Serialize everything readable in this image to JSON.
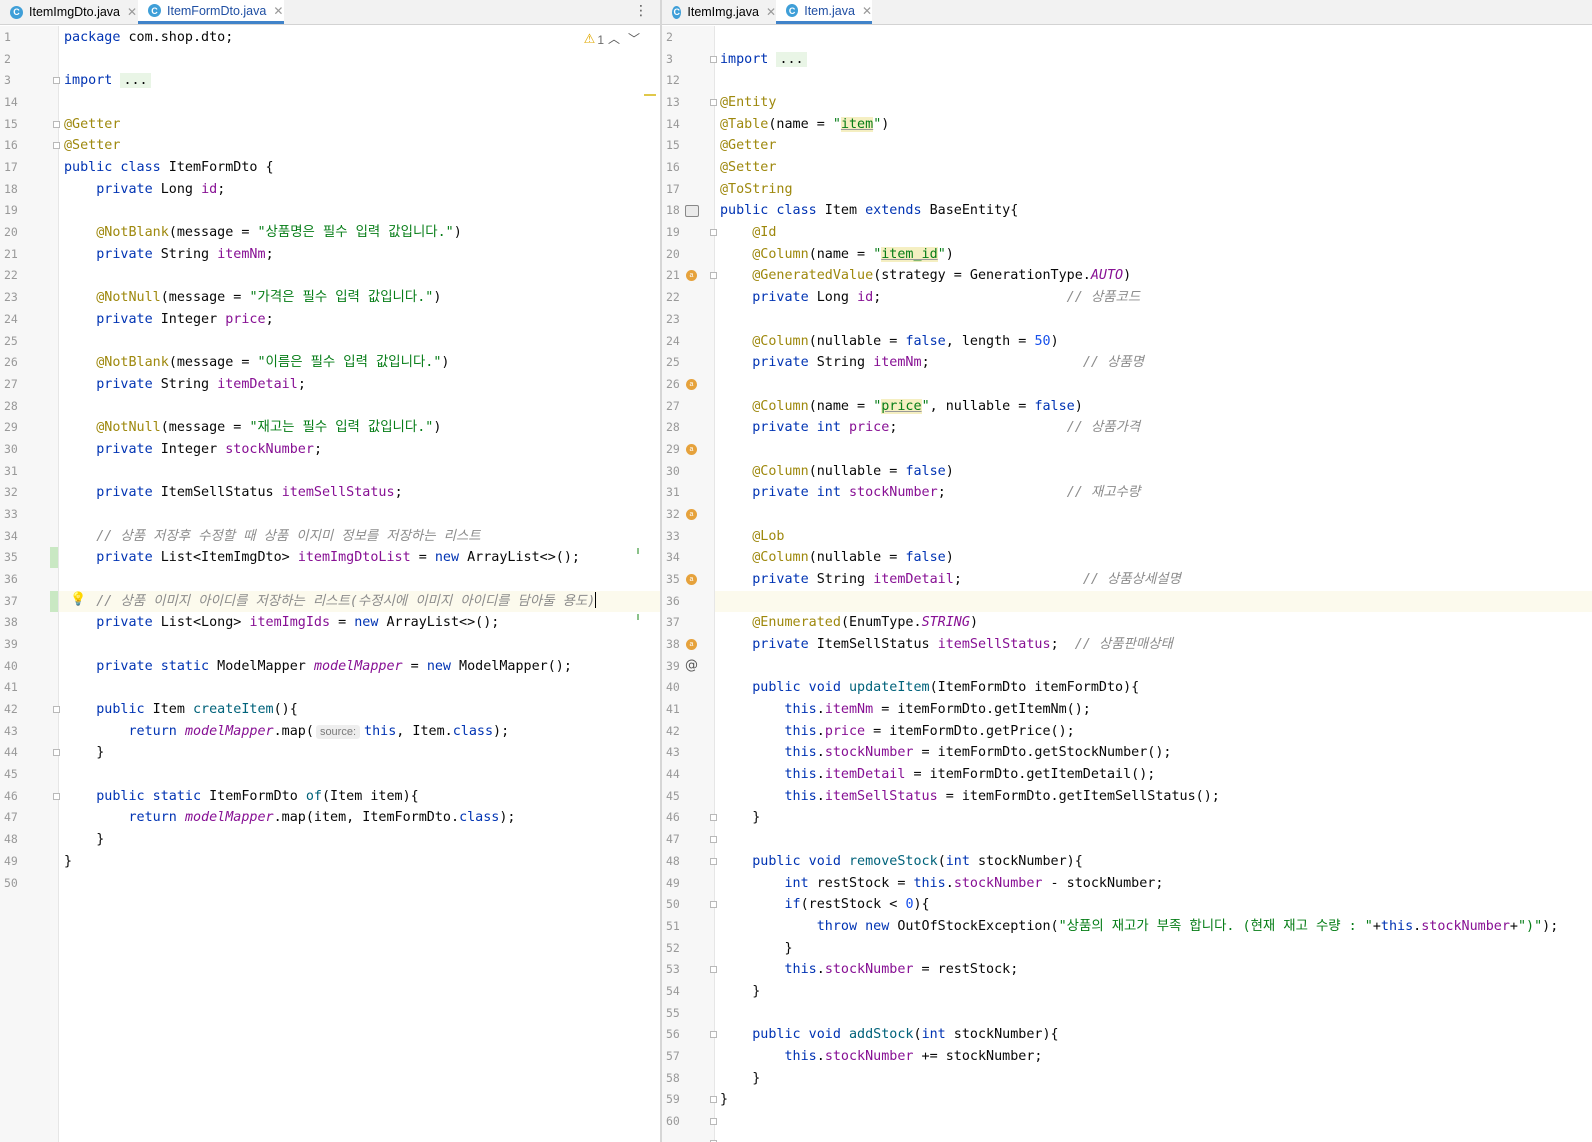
{
  "left_pane": {
    "tabs": [
      {
        "label": "ItemImgDto.java",
        "icon": "C",
        "active": false
      },
      {
        "label": "ItemFormDto.java",
        "icon": "C",
        "active": true
      }
    ],
    "warning_count": "1",
    "lines": [
      {
        "n": "1",
        "html": "<span class=\"kw\">package</span> com.shop.dto;"
      },
      {
        "n": "2",
        "html": ""
      },
      {
        "n": "3",
        "html": "<span class=\"kw\">import</span> <span class=\"fold-bg\">...</span>"
      },
      {
        "n": "14",
        "html": ""
      },
      {
        "n": "15",
        "html": "<span class=\"ann\">@Getter</span>"
      },
      {
        "n": "16",
        "html": "<span class=\"ann\">@Setter</span>"
      },
      {
        "n": "17",
        "html": "<span class=\"kw\">public class</span> ItemFormDto {"
      },
      {
        "n": "18",
        "html": "    <span class=\"kw\">private</span> Long <span class=\"fld\">id</span>;"
      },
      {
        "n": "19",
        "html": ""
      },
      {
        "n": "20",
        "html": "    <span class=\"ann\">@NotBlank</span>(message = <span class=\"str\">\"상품명은 필수 입력 값입니다.\"</span>)"
      },
      {
        "n": "21",
        "html": "    <span class=\"kw\">private</span> String <span class=\"fld\">itemNm</span>;"
      },
      {
        "n": "22",
        "html": ""
      },
      {
        "n": "23",
        "html": "    <span class=\"ann\">@NotNull</span>(message = <span class=\"str\">\"가격은 필수 입력 값입니다.\"</span>)"
      },
      {
        "n": "24",
        "html": "    <span class=\"kw\">private</span> Integer <span class=\"fld\">price</span>;"
      },
      {
        "n": "25",
        "html": ""
      },
      {
        "n": "26",
        "html": "    <span class=\"ann\">@NotBlank</span>(message = <span class=\"str\">\"이름은 필수 입력 값입니다.\"</span>)"
      },
      {
        "n": "27",
        "html": "    <span class=\"kw\">private</span> String <span class=\"fld\">itemDetail</span>;"
      },
      {
        "n": "28",
        "html": ""
      },
      {
        "n": "29",
        "html": "    <span class=\"ann\">@NotNull</span>(message = <span class=\"str\">\"재고는 필수 입력 값입니다.\"</span>)"
      },
      {
        "n": "30",
        "html": "    <span class=\"kw\">private</span> Integer <span class=\"fld\">stockNumber</span>;"
      },
      {
        "n": "31",
        "html": ""
      },
      {
        "n": "32",
        "html": "    <span class=\"kw\">private</span> ItemSellStatus <span class=\"fld\">itemSellStatus</span>;"
      },
      {
        "n": "33",
        "html": ""
      },
      {
        "n": "34",
        "html": "    <span class=\"cmt\">// 상품 저장후 수정할 때 상품 이지미 정보를 저장하는 리스트</span>"
      },
      {
        "n": "35",
        "html": "    <span class=\"kw\">private</span> List&lt;ItemImgDto&gt; <span class=\"fld\">itemImgDtoList</span> = <span class=\"kw\">new</span> ArrayList&lt;&gt;();"
      },
      {
        "n": "36",
        "html": ""
      },
      {
        "n": "37",
        "html": "    <span class=\"cmt\">// 상품 이미지 아이디를 저장하는 리스트(수정시에 이미지 아이디를 담아둘 용도)</span><span class=\"caret\"></span>",
        "current": true
      },
      {
        "n": "38",
        "html": "    <span class=\"kw\">private</span> List&lt;Long&gt; <span class=\"fld\">itemImgIds</span> = <span class=\"kw\">new</span> ArrayList&lt;&gt;();"
      },
      {
        "n": "39",
        "html": ""
      },
      {
        "n": "40",
        "html": "    <span class=\"kw\">private static</span> ModelMapper <span class=\"fldi\">modelMapper</span> = <span class=\"kw\">new</span> ModelMapper();"
      },
      {
        "n": "41",
        "html": ""
      },
      {
        "n": "42",
        "html": "    <span class=\"kw\">public</span> Item <span class=\"fn\">createItem</span>(){"
      },
      {
        "n": "43",
        "html": "        <span class=\"kw\">return</span> <span class=\"fldi\">modelMapper</span>.map(<span class=\"hint\">source:</span><span class=\"kw\">this</span>, Item.<span class=\"kw\">class</span>);"
      },
      {
        "n": "44",
        "html": "    }"
      },
      {
        "n": "45",
        "html": ""
      },
      {
        "n": "46",
        "html": "    <span class=\"kw\">public static</span> ItemFormDto <span class=\"fn\">of</span>(Item item){"
      },
      {
        "n": "47",
        "html": "        <span class=\"kw\">return</span> <span class=\"fldi\">modelMapper</span>.map(item, ItemFormDto.<span class=\"kw\">class</span>);"
      },
      {
        "n": "48",
        "html": "    }"
      },
      {
        "n": "49",
        "html": "}"
      },
      {
        "n": "50",
        "html": ""
      }
    ]
  },
  "right_pane": {
    "tabs": [
      {
        "label": "ItemImg.java",
        "icon": "C",
        "active": false
      },
      {
        "label": "Item.java",
        "icon": "C",
        "active": true
      }
    ],
    "lines": [
      {
        "n": "2",
        "html": ""
      },
      {
        "n": "3",
        "html": "<span class=\"kw\">import</span> <span class=\"fold-bg\">...</span>"
      },
      {
        "n": "12",
        "html": ""
      },
      {
        "n": "13",
        "html": "<span class=\"ann\">@Entity</span>"
      },
      {
        "n": "14",
        "html": "<span class=\"ann\">@Table</span>(name = <span class=\"str\">\"<span class=\"hl\">item</span>\"</span>)"
      },
      {
        "n": "15",
        "html": "<span class=\"ann\">@Getter</span>"
      },
      {
        "n": "16",
        "html": "<span class=\"ann\">@Setter</span>"
      },
      {
        "n": "17",
        "html": "<span class=\"ann\">@ToString</span>"
      },
      {
        "n": "18",
        "html": "<span class=\"kw\">public class</span> Item <span class=\"kw\">extends</span> BaseEntity{"
      },
      {
        "n": "19",
        "html": "    <span class=\"ann\">@Id</span>"
      },
      {
        "n": "20",
        "html": "    <span class=\"ann\">@Column</span>(name = <span class=\"str\">\"<span class=\"hl\">item_id</span>\"</span>)"
      },
      {
        "n": "21",
        "html": "    <span class=\"ann\">@GeneratedValue</span>(strategy = GenerationType.<span class=\"const\">AUTO</span>)"
      },
      {
        "n": "22",
        "html": "    <span class=\"kw\">private</span> Long <span class=\"fld\">id</span>;                       <span class=\"cmt\">// 상품코드</span>"
      },
      {
        "n": "23",
        "html": ""
      },
      {
        "n": "24",
        "html": "    <span class=\"ann\">@Column</span>(nullable = <span class=\"kw\">false</span>, length = <span class=\"num-lit\">50</span>)"
      },
      {
        "n": "25",
        "html": "    <span class=\"kw\">private</span> String <span class=\"fld\">itemNm</span>;                   <span class=\"cmt\">// 상품명</span>"
      },
      {
        "n": "26",
        "html": ""
      },
      {
        "n": "27",
        "html": "    <span class=\"ann\">@Column</span>(name = <span class=\"str\">\"<span class=\"hl\">price</span>\"</span>, nullable = <span class=\"kw\">false</span>)"
      },
      {
        "n": "28",
        "html": "    <span class=\"kw\">private int</span> <span class=\"fld\">price</span>;                     <span class=\"cmt\">// 상품가격</span>"
      },
      {
        "n": "29",
        "html": ""
      },
      {
        "n": "30",
        "html": "    <span class=\"ann\">@Column</span>(nullable = <span class=\"kw\">false</span>)"
      },
      {
        "n": "31",
        "html": "    <span class=\"kw\">private int</span> <span class=\"fld\">stockNumber</span>;               <span class=\"cmt\">// 재고수량</span>"
      },
      {
        "n": "32",
        "html": ""
      },
      {
        "n": "33",
        "html": "    <span class=\"ann\">@Lob</span>"
      },
      {
        "n": "34",
        "html": "    <span class=\"ann\">@Column</span>(nullable = <span class=\"kw\">false</span>)"
      },
      {
        "n": "35",
        "html": "    <span class=\"kw\">private</span> String <span class=\"fld\">itemDetail</span>;               <span class=\"cmt\">// 상품상세설명</span>"
      },
      {
        "n": "36",
        "html": "",
        "current": true
      },
      {
        "n": "37",
        "html": "    <span class=\"ann\">@Enumerated</span>(EnumType.<span class=\"const\">STRING</span>)"
      },
      {
        "n": "38",
        "html": "    <span class=\"kw\">private</span> ItemSellStatus <span class=\"fld\">itemSellStatus</span>;  <span class=\"cmt\">// 상품판매상태</span>"
      },
      {
        "n": "39",
        "html": ""
      },
      {
        "n": "40",
        "html": "    <span class=\"kw\">public void</span> <span class=\"fn\">updateItem</span>(ItemFormDto itemFormDto){"
      },
      {
        "n": "41",
        "html": "        <span class=\"kw\">this</span>.<span class=\"fld\">itemNm</span> = itemFormDto.getItemNm();"
      },
      {
        "n": "42",
        "html": "        <span class=\"kw\">this</span>.<span class=\"fld\">price</span> = itemFormDto.getPrice();"
      },
      {
        "n": "43",
        "html": "        <span class=\"kw\">this</span>.<span class=\"fld\">stockNumber</span> = itemFormDto.getStockNumber();"
      },
      {
        "n": "44",
        "html": "        <span class=\"kw\">this</span>.<span class=\"fld\">itemDetail</span> = itemFormDto.getItemDetail();"
      },
      {
        "n": "45",
        "html": "        <span class=\"kw\">this</span>.<span class=\"fld\">itemSellStatus</span> = itemFormDto.getItemSellStatus();"
      },
      {
        "n": "46",
        "html": "    }"
      },
      {
        "n": "47",
        "html": ""
      },
      {
        "n": "48",
        "html": "    <span class=\"kw\">public void</span> <span class=\"fn\">removeStock</span>(<span class=\"kw\">int</span> stockNumber){"
      },
      {
        "n": "49",
        "html": "        <span class=\"kw\">int</span> restStock = <span class=\"kw\">this</span>.<span class=\"fld\">stockNumber</span> - stockNumber;"
      },
      {
        "n": "50",
        "html": "        <span class=\"kw\">if</span>(restStock &lt; <span class=\"num-lit\">0</span>){"
      },
      {
        "n": "51",
        "html": "            <span class=\"kw\">throw new</span> OutOfStockException(<span class=\"str\">\"상품의 재고가 부족 합니다. (현재 재고 수량 : \"</span>+<span class=\"kw\">this</span>.<span class=\"fld\">stockNumber</span>+<span class=\"str\">\")\"</span>);"
      },
      {
        "n": "52",
        "html": "        }"
      },
      {
        "n": "53",
        "html": "        <span class=\"kw\">this</span>.<span class=\"fld\">stockNumber</span> = restStock;"
      },
      {
        "n": "54",
        "html": "    }"
      },
      {
        "n": "55",
        "html": ""
      },
      {
        "n": "56",
        "html": "    <span class=\"kw\">public void</span> <span class=\"fn\">addStock</span>(<span class=\"kw\">int</span> stockNumber){"
      },
      {
        "n": "57",
        "html": "        <span class=\"kw\">this</span>.<span class=\"fld\">stockNumber</span> += stockNumber;"
      },
      {
        "n": "58",
        "html": "    }"
      },
      {
        "n": "59",
        "html": "}"
      },
      {
        "n": "60",
        "html": ""
      }
    ]
  }
}
